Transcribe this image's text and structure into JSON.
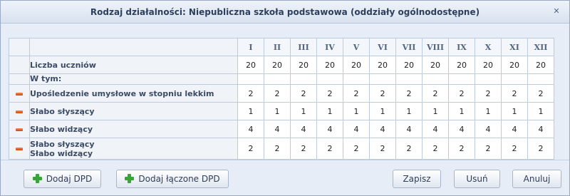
{
  "dialog": {
    "title": "Rodzaj działalności: Niepubliczna szkoła podstawowa (oddziały ogólnodostępne)",
    "close_icon": "close-icon"
  },
  "table": {
    "columns": [
      "I",
      "II",
      "III",
      "IV",
      "V",
      "VI",
      "VII",
      "VIII",
      "IX",
      "X",
      "XI",
      "XII"
    ],
    "rows": [
      {
        "label": "Liczba uczniów",
        "removable": false,
        "values": [
          "20",
          "20",
          "20",
          "20",
          "20",
          "20",
          "20",
          "20",
          "20",
          "20",
          "20",
          "20"
        ]
      },
      {
        "label": "W tym:",
        "removable": false,
        "values": []
      },
      {
        "label": "Upośledzenie umysłowe w stopniu lekkim",
        "removable": true,
        "values": [
          "2",
          "2",
          "2",
          "2",
          "2",
          "2",
          "2",
          "2",
          "2",
          "2",
          "2",
          "2"
        ]
      },
      {
        "label": "Słabo słyszący",
        "removable": true,
        "values": [
          "1",
          "1",
          "1",
          "1",
          "1",
          "1",
          "1",
          "1",
          "1",
          "1",
          "1",
          "1"
        ]
      },
      {
        "label": "Słabo widzący",
        "removable": true,
        "values": [
          "4",
          "4",
          "4",
          "4",
          "4",
          "4",
          "4",
          "4",
          "4",
          "4",
          "4",
          "4"
        ]
      },
      {
        "label_line1": "Słabo słyszący",
        "label_line2": "Słabo widzący",
        "removable": true,
        "values": [
          "2",
          "2",
          "2",
          "2",
          "2",
          "2",
          "2",
          "2",
          "2",
          "2",
          "2",
          "2"
        ]
      }
    ]
  },
  "footer": {
    "add_dpd": "Dodaj DPD",
    "add_combined_dpd": "Dodaj łączone DPD",
    "save": "Zapisz",
    "delete": "Usuń",
    "cancel": "Anuluj"
  },
  "colors": {
    "remove_icon": "#e0662a",
    "add_icon": "#3aa43a",
    "header_text": "#53657f"
  }
}
